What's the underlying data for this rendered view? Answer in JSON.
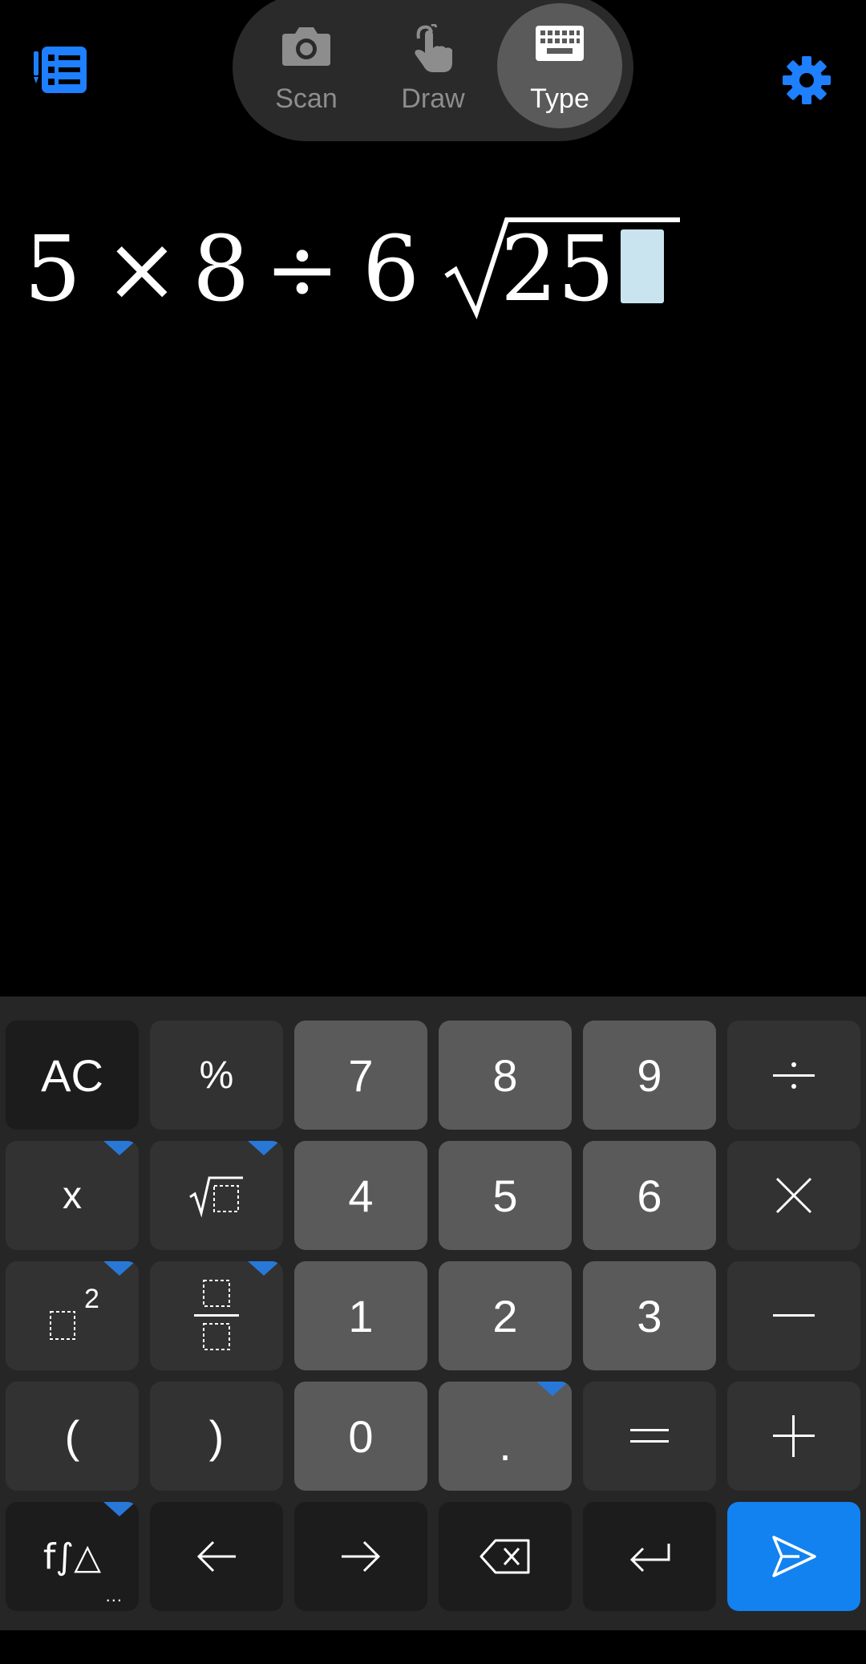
{
  "modes": [
    {
      "label": "Scan",
      "icon": "camera-icon",
      "active": false
    },
    {
      "label": "Draw",
      "icon": "hand-draw-icon",
      "active": false
    },
    {
      "label": "Type",
      "icon": "keyboard-icon",
      "active": true
    }
  ],
  "topbar": {
    "history_icon": "history-list-icon",
    "settings_icon": "gear-icon"
  },
  "expression": {
    "tokens": [
      "5",
      "×",
      "8",
      "÷",
      "6"
    ],
    "sqrt_symbol": "√",
    "radicand": "25"
  },
  "keypad": {
    "row1": {
      "ac": "AC",
      "percent": "%",
      "k7": "7",
      "k8": "8",
      "k9": "9",
      "divide": "÷"
    },
    "row2": {
      "x": "x",
      "sqrt": "√□",
      "k4": "4",
      "k5": "5",
      "k6": "6",
      "multiply": "×"
    },
    "row3": {
      "power_base": "□",
      "power_exp": "2",
      "fraction_top": "□",
      "fraction_bottom": "□",
      "k1": "1",
      "k2": "2",
      "k3": "3",
      "minus": "—"
    },
    "row4": {
      "lparen": "(",
      "rparen": ")",
      "k0": "0",
      "dot": ".",
      "equals": "=",
      "plus": "+"
    },
    "row5": {
      "functions": "f∫△",
      "functions_more": "...",
      "left": "←",
      "right": "→",
      "backspace_icon": "backspace-icon",
      "enter_icon": "enter-icon",
      "send_icon": "send-icon"
    }
  },
  "colors": {
    "accent": "#1282f0",
    "active_tab": "#5a5a5a",
    "cursor": "#c9e4ee"
  }
}
